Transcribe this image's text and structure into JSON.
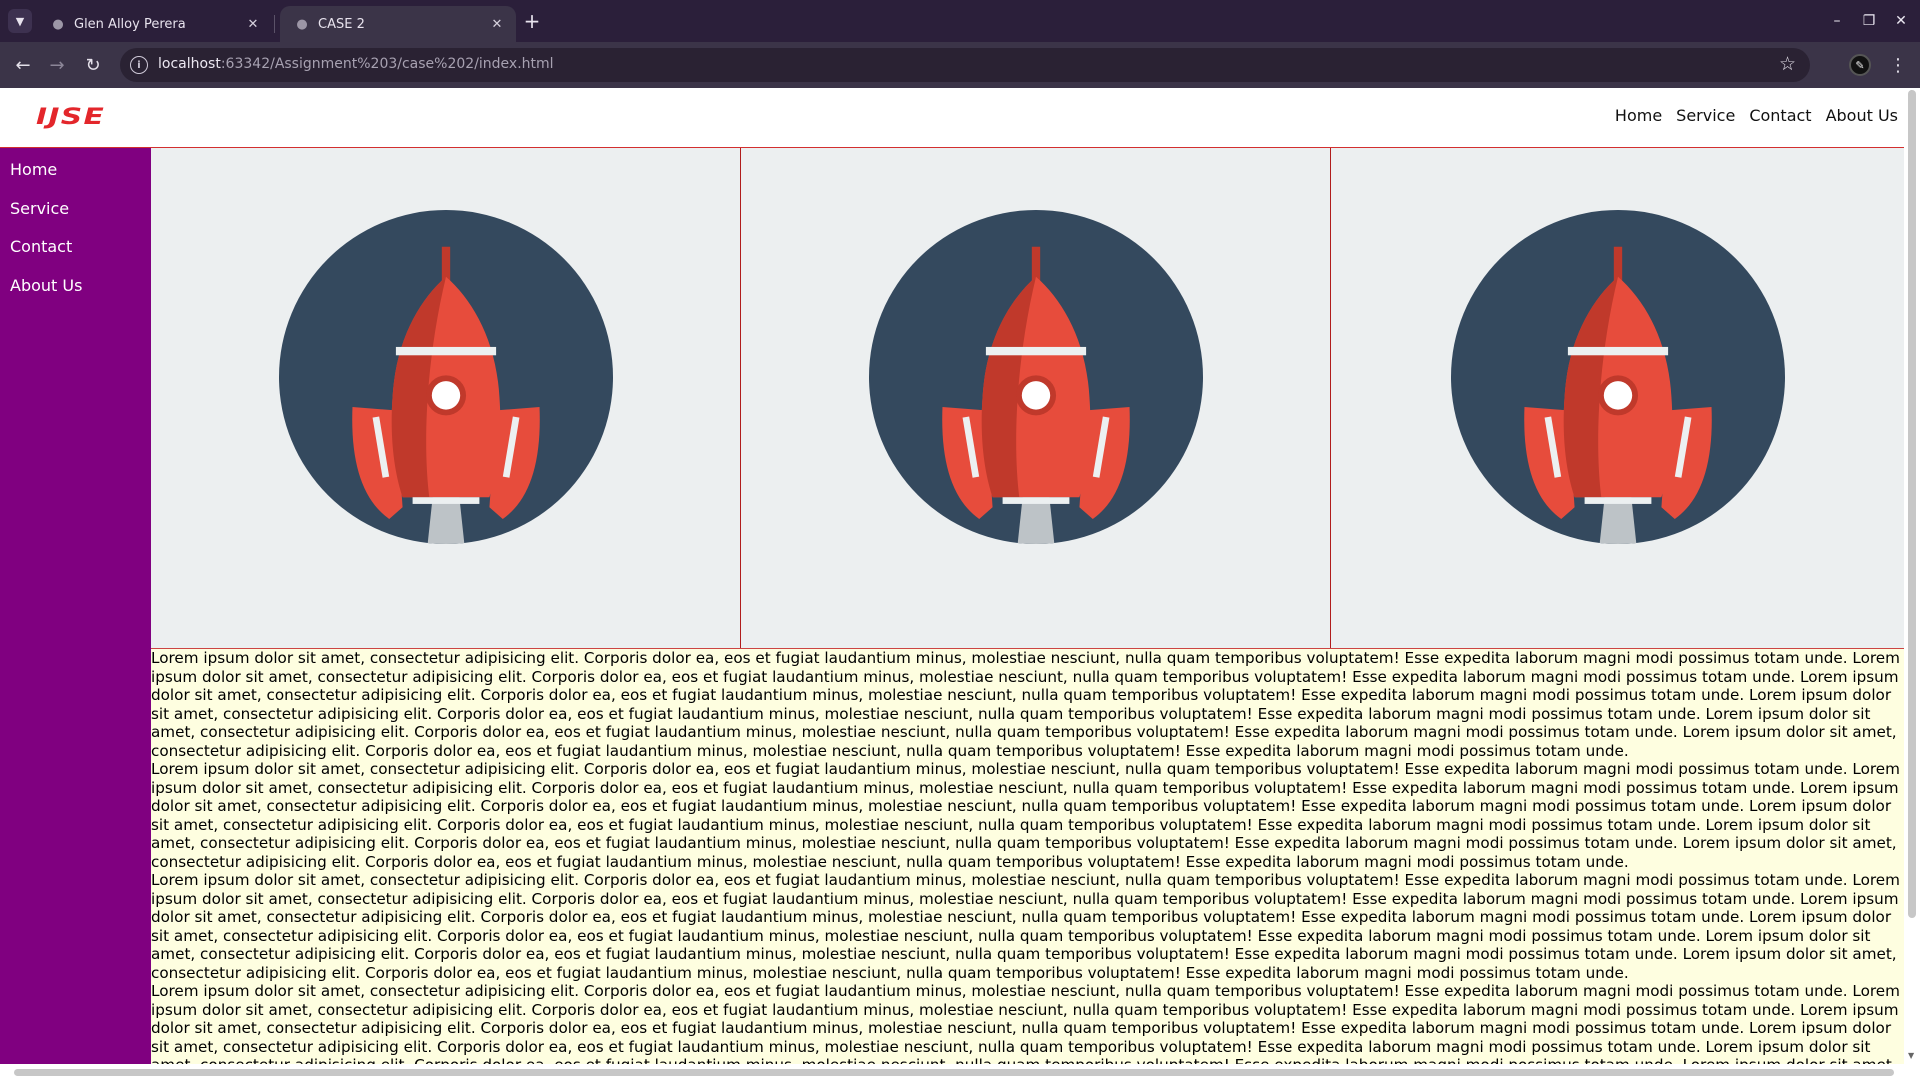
{
  "browser": {
    "tabs": [
      {
        "title": "Glen Alloy Perera",
        "active": false
      },
      {
        "title": "CASE 2",
        "active": true
      }
    ],
    "url_host": "localhost",
    "url_rest": ":63342/Assignment%203/case%202/index.html"
  },
  "site": {
    "logo_text": "IJSE",
    "top_nav": [
      "Home",
      "Service",
      "Contact",
      "About Us"
    ],
    "side_nav": [
      "Home",
      "Service",
      "Contact",
      "About Us"
    ],
    "panel_icon": "rocket-icon",
    "paragraph": "Lorem ipsum dolor sit amet, consectetur adipisicing elit. Corporis dolor ea, eos et fugiat laudantium minus, molestiae nesciunt, nulla quam temporibus voluptatem! Esse expedita laborum magni modi possimus totam unde. Lorem ipsum dolor sit amet, consectetur adipisicing elit. Corporis dolor ea, eos et fugiat laudantium minus, molestiae nesciunt, nulla quam temporibus voluptatem! Esse expedita laborum magni modi possimus totam unde. Lorem ipsum dolor sit amet, consectetur adipisicing elit. Corporis dolor ea, eos et fugiat laudantium minus, molestiae nesciunt, nulla quam temporibus voluptatem! Esse expedita laborum magni modi possimus totam unde. Lorem ipsum dolor sit amet, consectetur adipisicing elit. Corporis dolor ea, eos et fugiat laudantium minus, molestiae nesciunt, nulla quam temporibus voluptatem! Esse expedita laborum magni modi possimus totam unde. Lorem ipsum dolor sit amet, consectetur adipisicing elit. Corporis dolor ea, eos et fugiat laudantium minus, molestiae nesciunt, nulla quam temporibus voluptatem! Esse expedita laborum magni modi possimus totam unde. Lorem ipsum dolor sit amet, consectetur adipisicing elit. Corporis dolor ea, eos et fugiat laudantium minus, molestiae nesciunt, nulla quam temporibus voluptatem! Esse expedita laborum magni modi possimus totam unde."
  },
  "colors": {
    "sidebar": "#800080",
    "panel_bg": "#eceff0",
    "text_bg": "#fefee0",
    "accent_red": "#e3262b"
  }
}
